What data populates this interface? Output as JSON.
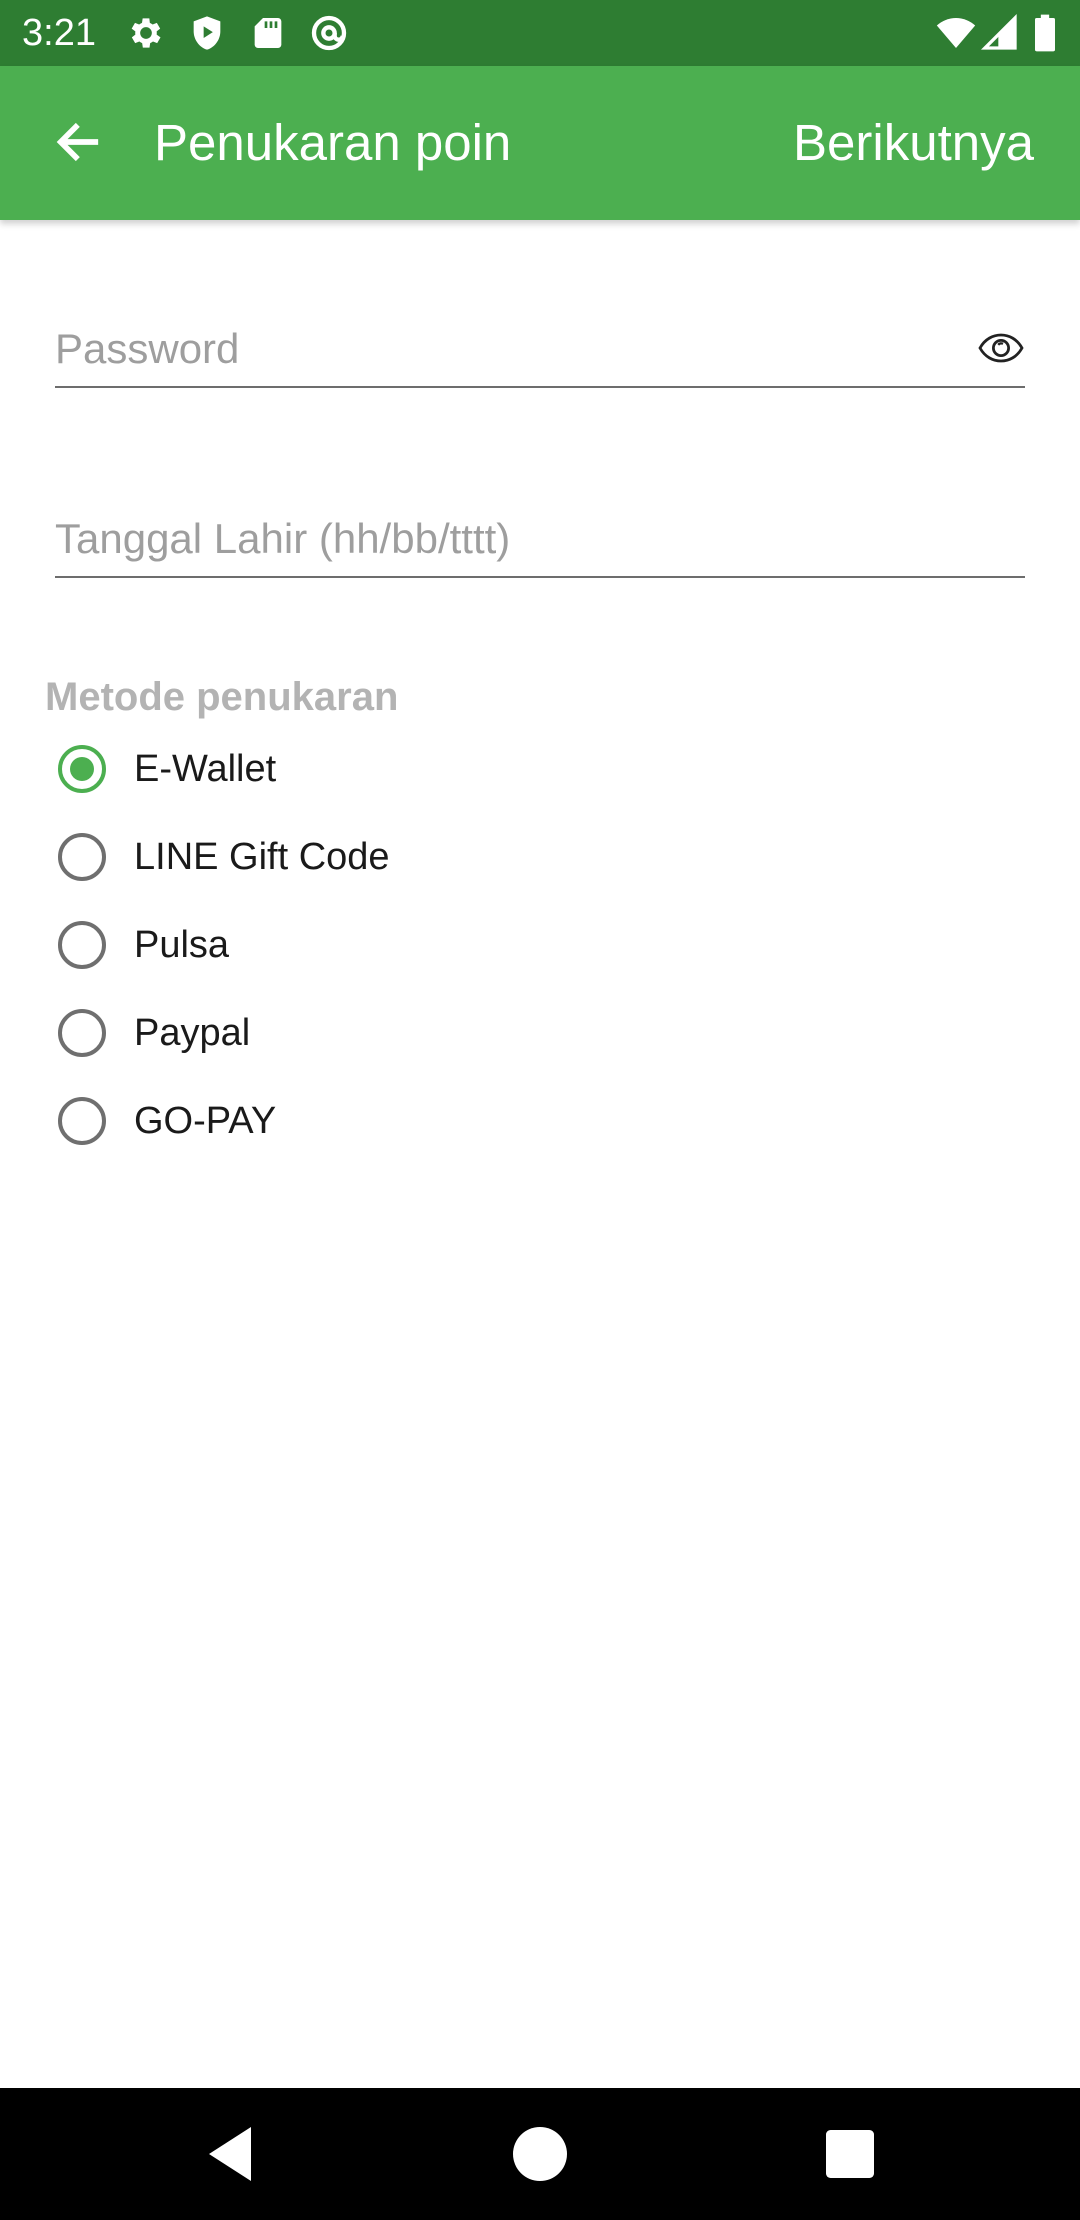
{
  "status_bar": {
    "time": "3:21",
    "icons_left": [
      "gear-icon",
      "shield-play-icon",
      "sd-card-icon",
      "at-sign-icon"
    ],
    "icons_right": [
      "wifi-icon",
      "cellular-signal-icon",
      "battery-icon"
    ]
  },
  "app_bar": {
    "back_icon": "arrow-back-icon",
    "title": "Penukaran poin",
    "next_label": "Berikutnya",
    "color": "#4caf50"
  },
  "form": {
    "password": {
      "placeholder": "Password",
      "value": "",
      "toggle_icon": "eye-icon"
    },
    "birthdate": {
      "placeholder": "Tanggal Lahir (hh/bb/tttt)",
      "value": ""
    }
  },
  "redeem_method": {
    "label": "Metode penukaran",
    "options": [
      {
        "label": "E-Wallet",
        "selected": true
      },
      {
        "label": "LINE Gift Code",
        "selected": false
      },
      {
        "label": "Pulsa",
        "selected": false
      },
      {
        "label": "Paypal",
        "selected": false
      },
      {
        "label": "GO-PAY",
        "selected": false
      }
    ],
    "accent_color": "#4caf50"
  },
  "nav_bar": {
    "buttons": [
      "back-triangle-icon",
      "home-circle-icon",
      "recents-square-icon"
    ]
  }
}
